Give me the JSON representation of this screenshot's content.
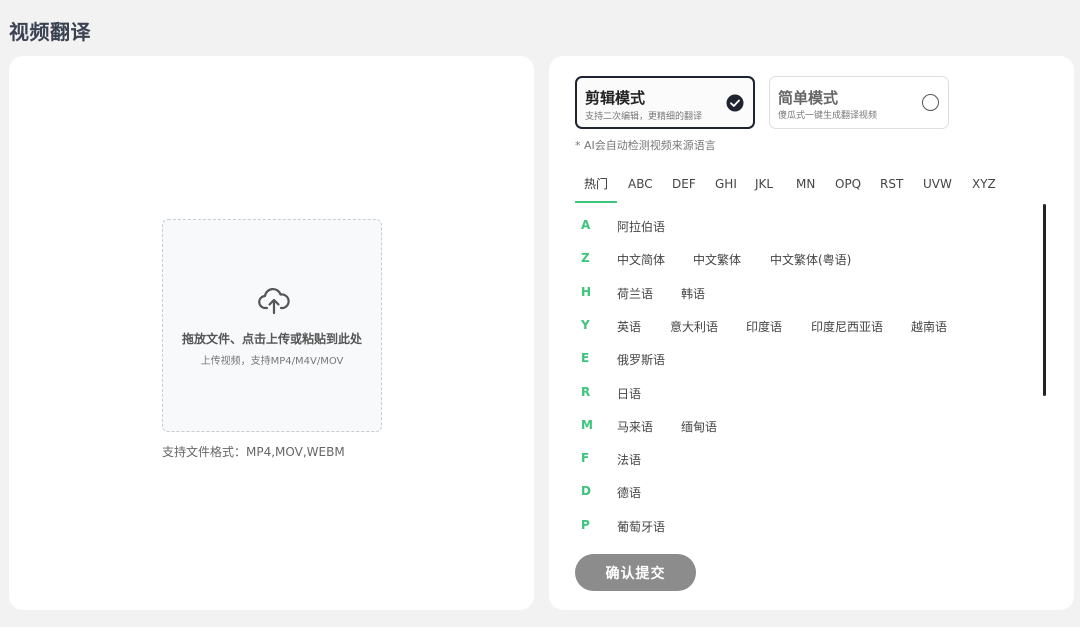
{
  "page": {
    "title": "视频翻译"
  },
  "upload": {
    "title": "拖放文件、点击上传或粘贴到此处",
    "subtitle": "上传视频，支持MP4/M4V/MOV",
    "formats": "支持文件格式：MP4,MOV,WEBM"
  },
  "modes": [
    {
      "title": "剪辑模式",
      "subtitle": "支持二次编辑，更精细的翻译",
      "selected": true
    },
    {
      "title": "简单模式",
      "subtitle": "傻瓜式一键生成翻译视频",
      "selected": false
    }
  ],
  "hint": "* AI会自动检测视频来源语言",
  "tabs": [
    "热门",
    "ABC",
    "DEF",
    "GHI",
    "JKL",
    "MN",
    "OPQ",
    "RST",
    "UVW",
    "XYZ"
  ],
  "active_tab": "热门",
  "accent_color": "#3bc47a",
  "languages": [
    {
      "letter": "A",
      "items": [
        "阿拉伯语"
      ]
    },
    {
      "letter": "Z",
      "items": [
        "中文简体",
        "中文繁体",
        "中文繁体(粤语)"
      ]
    },
    {
      "letter": "H",
      "items": [
        "荷兰语",
        "韩语"
      ]
    },
    {
      "letter": "Y",
      "items": [
        "英语",
        "意大利语",
        "印度语",
        "印度尼西亚语",
        "越南语"
      ]
    },
    {
      "letter": "E",
      "items": [
        "俄罗斯语"
      ]
    },
    {
      "letter": "R",
      "items": [
        "日语"
      ]
    },
    {
      "letter": "M",
      "items": [
        "马来语",
        "缅甸语"
      ]
    },
    {
      "letter": "F",
      "items": [
        "法语"
      ]
    },
    {
      "letter": "D",
      "items": [
        "德语"
      ]
    },
    {
      "letter": "P",
      "items": [
        "葡萄牙语"
      ]
    }
  ],
  "submit_label": "确认提交"
}
